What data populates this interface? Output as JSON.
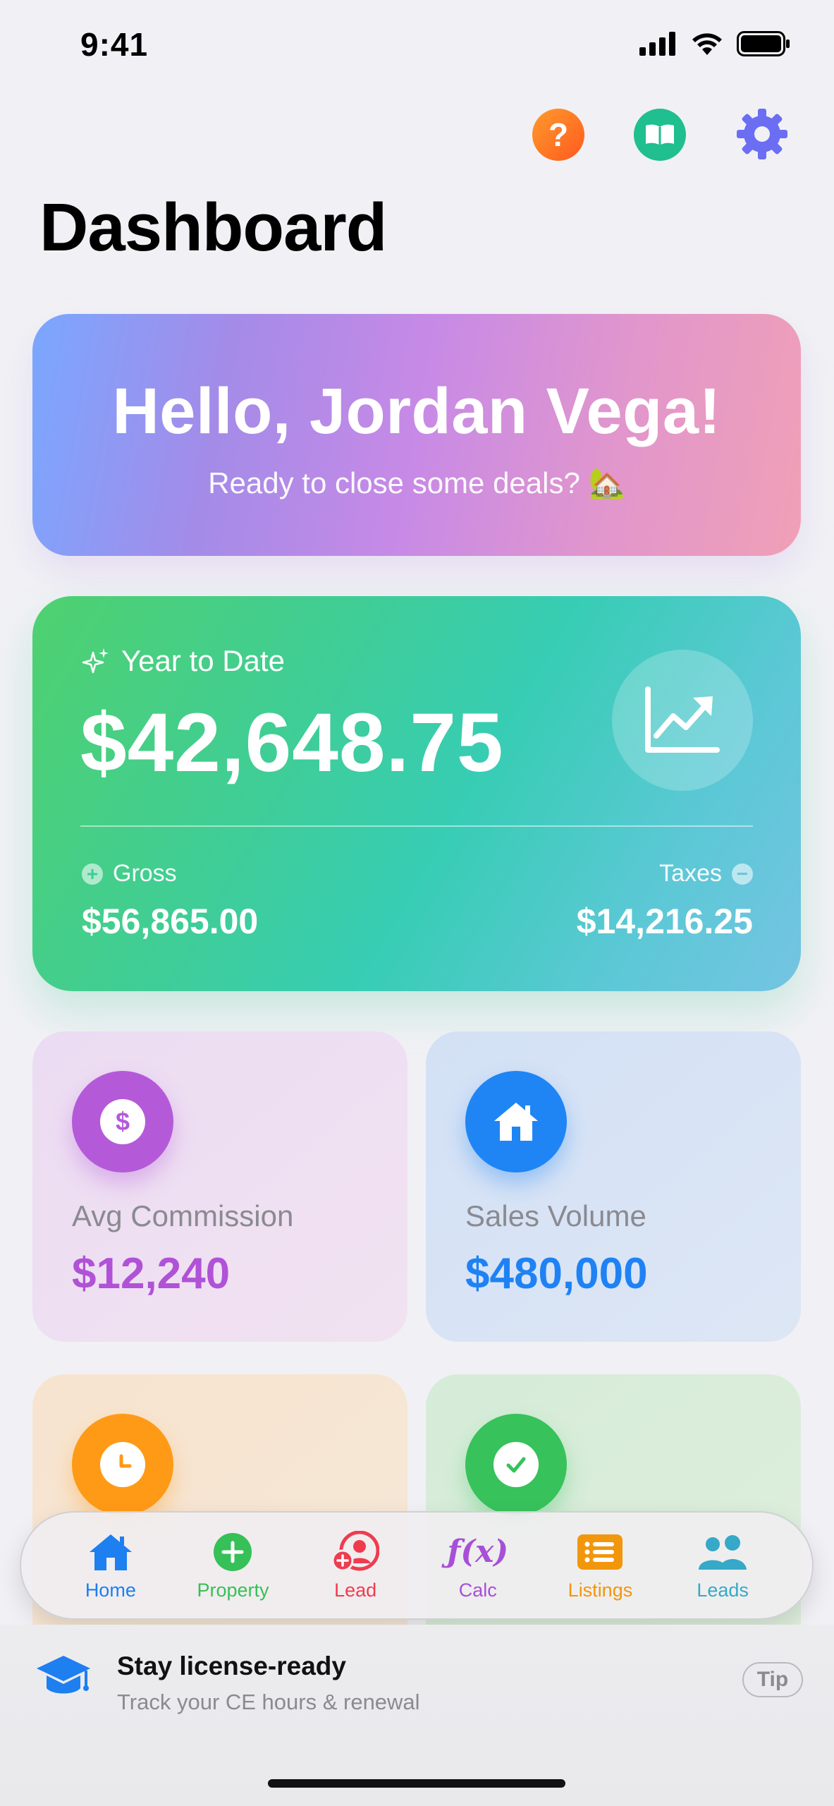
{
  "status_bar": {
    "time": "9:41"
  },
  "header": {
    "title": "Dashboard"
  },
  "top_actions": {
    "help_glyph": "?",
    "icons": [
      "question-icon",
      "book-icon",
      "gear-icon"
    ],
    "colors": {
      "help": "#ff6a1f",
      "guide": "#1fbf8f",
      "settings": "#6b6ef2"
    }
  },
  "greeting": {
    "title": "Hello, Jordan Vega!",
    "subtitle": "Ready to close some deals? 🏡"
  },
  "ytd": {
    "label": "Year to Date",
    "amount": "$42,648.75",
    "gross_label": "Gross",
    "gross_value": "$56,865.00",
    "taxes_label": "Taxes",
    "taxes_value": "$14,216.25"
  },
  "stats": [
    {
      "label": "Avg Commission",
      "value": "$12,240",
      "icon": "dollar-icon",
      "color": "#b45ad9"
    },
    {
      "label": "Sales Volume",
      "value": "$480,000",
      "icon": "house-icon",
      "color": "#1f85f5"
    },
    {
      "label": "",
      "value": "",
      "icon": "clock-icon",
      "color": "#ff9a16"
    },
    {
      "label": "",
      "value": "",
      "icon": "checkmark-icon",
      "color": "#37c25c"
    }
  ],
  "tabs": [
    {
      "label": "Home",
      "icon": "house-icon"
    },
    {
      "label": "Property",
      "icon": "plus-circle-icon"
    },
    {
      "label": "Lead",
      "icon": "person-add-icon"
    },
    {
      "label": "Calc",
      "icon": "fx-icon",
      "glyph": "ƒ(x)"
    },
    {
      "label": "Listings",
      "icon": "list-icon"
    },
    {
      "label": "Leads",
      "icon": "people-icon"
    }
  ],
  "banner": {
    "title": "Stay license-ready",
    "subtitle": "Track your CE hours & renewal",
    "button": "Tip"
  }
}
